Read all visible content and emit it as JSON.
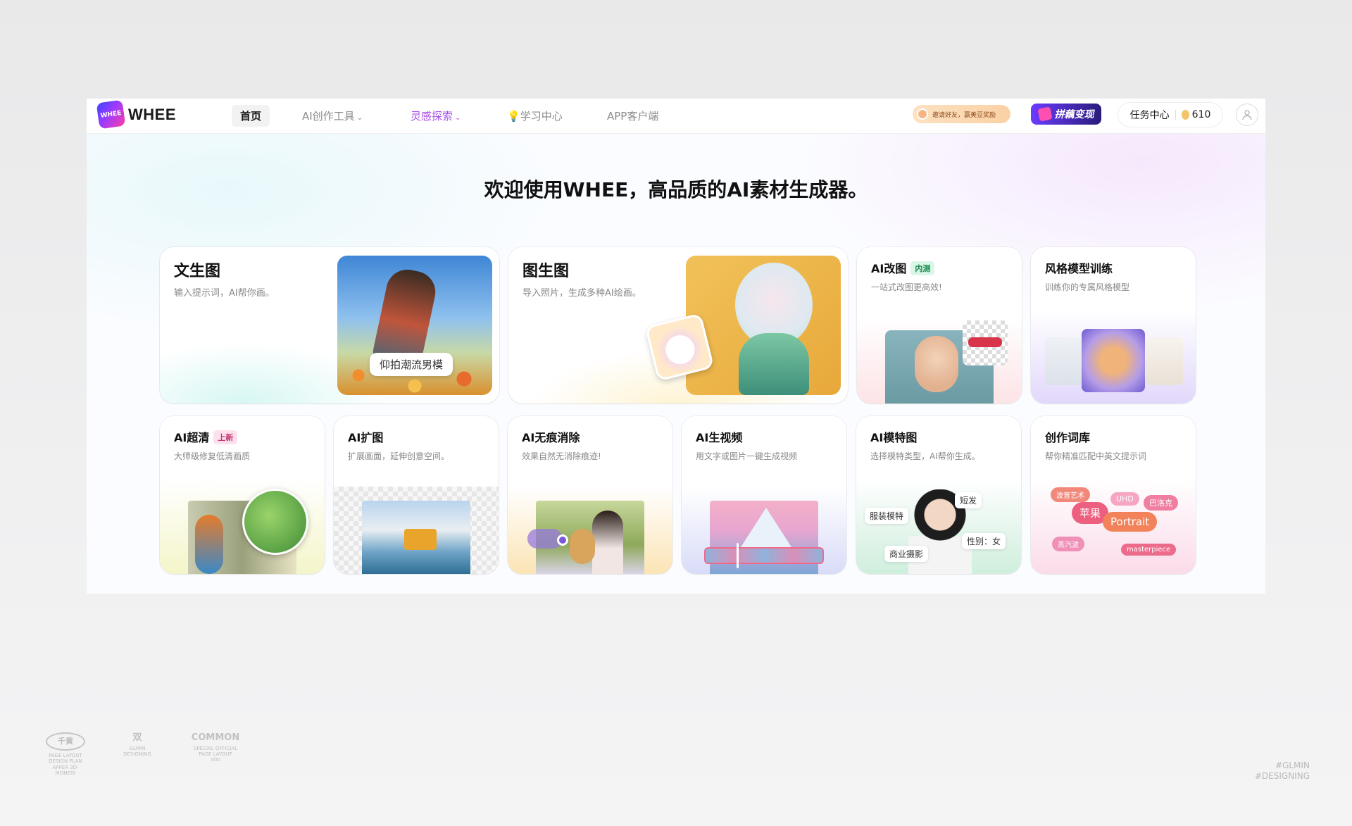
{
  "header": {
    "logo_mark": "WHEE",
    "logo_text": "WHEE",
    "nav": [
      {
        "label": "首页"
      },
      {
        "label": "AI创作工具"
      },
      {
        "label": "灵感探索"
      },
      {
        "label": "学习中心"
      },
      {
        "label": "APP客户端"
      }
    ],
    "invite_text": "邀请好友，赢美豆奖励",
    "pin_text": "拼藕变现",
    "tasks_label": "任务中心",
    "beans": "610"
  },
  "headline": "欢迎使用WHEE，高品质的AI素材生成器。",
  "cards_top": [
    {
      "title": "文生图",
      "sub": "输入提示词，AI帮你画。",
      "tag": "仰拍潮流男模"
    },
    {
      "title": "图生图",
      "sub": "导入照片，生成多种AI绘画。"
    },
    {
      "title": "AI改图",
      "badge": "内测",
      "sub": "一站式改图更高效!"
    },
    {
      "title": "风格模型训练",
      "sub": "训练你的专属风格模型"
    }
  ],
  "cards_bottom": [
    {
      "title": "AI超清",
      "badge": "上新",
      "sub": "大师级修复低清画质"
    },
    {
      "title": "AI扩图",
      "sub": "扩展画面，延伸创意空间。"
    },
    {
      "title": "AI无痕消除",
      "sub": "效果自然无消除痕迹!"
    },
    {
      "title": "AI生视频",
      "sub": "用文字或图片一键生成视频"
    },
    {
      "title": "AI模特图",
      "sub": "选择模特类型，AI帮你生成。"
    },
    {
      "title": "创作词库",
      "sub": "帮你精准匹配中英文提示词"
    }
  ],
  "model_tags": {
    "hair": "短发",
    "clothing": "服装模特",
    "gender": "性别：女",
    "commercial": "商业摄影"
  },
  "word_chips": {
    "a": "波普艺术",
    "b": "UHD",
    "c": "巴洛克",
    "d": "苹果",
    "e": "Portrait",
    "f": "蒸汽波",
    "g": "masterpiece"
  },
  "footer": {
    "logo1_mark": "千黄",
    "logo1_line1": "PAGE LAYOUT",
    "logo1_line2": "DESIGN PLAN",
    "logo1_line3": "APPER 3D-MONEDI",
    "logo2_mark": "双",
    "logo2_line1": "GLMIN",
    "logo2_line2": "DESIGNING",
    "logo3_mark": "COMMON",
    "logo3_line1": "SPECIAL OFFICIAL",
    "logo3_line2": "PAGE LAYOUT",
    "logo3_line3": "000",
    "hashtag1": "#GLMIN",
    "hashtag2": "#DESIGNING"
  },
  "colors": {
    "accent_purple": "#a84ee8",
    "badge_green": "#17894f",
    "badge_pink": "#c23170"
  }
}
